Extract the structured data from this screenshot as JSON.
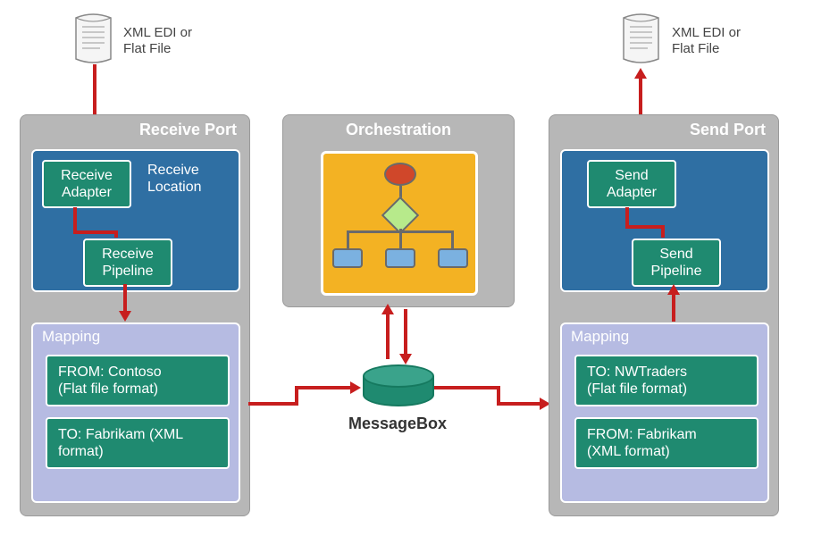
{
  "documents": {
    "input_label": "XML EDI or\nFlat File",
    "output_label": "XML EDI or\nFlat File"
  },
  "receive": {
    "panel_title": "Receive Port",
    "location_label": "Receive\nLocation",
    "adapter_label": "Receive\nAdapter",
    "pipeline_label": "Receive\nPipeline"
  },
  "receive_mapping": {
    "title": "Mapping",
    "from": "FROM: Contoso\n(Flat file format)",
    "to": "TO: Fabrikam (XML\nformat)"
  },
  "orchestration": {
    "panel_title": "Orchestration"
  },
  "messagebox": {
    "label": "MessageBox"
  },
  "send": {
    "panel_title": "Send Port",
    "adapter_label": "Send\nAdapter",
    "pipeline_label": "Send\nPipeline"
  },
  "send_mapping": {
    "title": "Mapping",
    "to": "TO: NWTraders\n(Flat file format)",
    "from": "FROM: Fabrikam\n(XML format)"
  },
  "colors": {
    "arrow": "#c71e1e",
    "panel_bg": "#b7b7b7",
    "blue": "#2f6fa3",
    "green": "#1f8a70",
    "mapping_bg": "#b6bbe2",
    "orch_bg": "#f3b223"
  }
}
